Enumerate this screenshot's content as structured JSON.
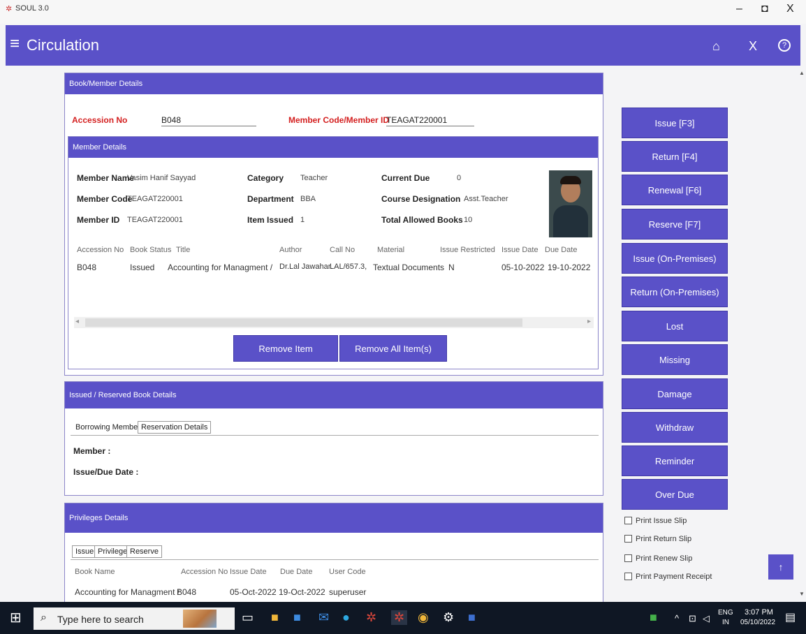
{
  "window": {
    "app_title": "SOUL 3.0",
    "minimize": "–",
    "restore": "◘",
    "close": "X"
  },
  "header": {
    "title": "Circulation",
    "menu_icon": "≡",
    "home_icon": "⌂",
    "close_icon": "X",
    "help_icon": "?"
  },
  "book_member": {
    "section_title": "Book/Member Details",
    "accession_label": "Accession No",
    "accession_value": "B048",
    "member_code_label": "Member Code/Member ID",
    "member_code_value": "TEAGAT220001"
  },
  "member_details": {
    "section_title": "Member Details",
    "fields": {
      "member_name_label": "Member Name",
      "member_name": "Vasim Hanif Sayyad",
      "member_code_label": "Member Code",
      "member_code": "TEAGAT220001",
      "member_id_label": "Member ID",
      "member_id": "TEAGAT220001",
      "category_label": "Category",
      "category": "Teacher",
      "department_label": "Department",
      "department": "BBA",
      "item_issued_label": "Item Issued",
      "item_issued": "1",
      "current_due_label": "Current Due",
      "current_due": "0",
      "course_label": "Course Designation",
      "course": "Asst.Teacher",
      "total_allowed_label": "Total Allowed Books",
      "total_allowed": "10"
    },
    "table_headers": [
      "Accession No",
      "Book Status",
      "Title",
      "Author",
      "Call No",
      "Material",
      "Issue Restricted",
      "Issue Date",
      "Due Date"
    ],
    "table_row": [
      "B048",
      "Issued",
      "Accounting for Managment /",
      "Dr.Lal Jawahar.",
      "LAL/657.3,",
      "Textual Documents",
      "N",
      "05-10-2022",
      "19-10-2022"
    ],
    "remove_item": "Remove Item",
    "remove_all": "Remove All Item(s)"
  },
  "issued_reserved": {
    "section_title": "Issued / Reserved Book Details",
    "tabs": [
      "Borrowing Member",
      "Reservation Details"
    ],
    "member_label": "Member :",
    "issue_due_label": "Issue/Due Date :"
  },
  "privileges": {
    "section_title": "Privileges Details",
    "tabs": [
      "Issue",
      "Privilege",
      "Reserve"
    ],
    "headers": [
      "Book Name",
      "Accession No",
      "Issue Date",
      "Due Date",
      "User Code"
    ],
    "row": [
      "Accounting for Managment /",
      "B048",
      "05-Oct-2022",
      "19-Oct-2022",
      "superuser"
    ]
  },
  "actions": [
    "Issue [F3]",
    "Return [F4]",
    "Renewal [F6]",
    "Reserve [F7]",
    "Issue (On-Premises)",
    "Return (On-Premises)",
    "Lost",
    "Missing",
    "Damage",
    "Withdraw",
    "Reminder",
    "Over Due"
  ],
  "print_options": [
    "Print Issue Slip",
    "Print Return Slip",
    "Print Renew Slip",
    "Print Payment Receipt"
  ],
  "scroll_top_icon": "↑",
  "taskbar": {
    "search_placeholder": "Type here to search",
    "lang_top": "ENG",
    "lang_bottom": "IN",
    "time": "3:07 PM",
    "date": "05/10/2022"
  },
  "colors": {
    "accent": "#5a51c8",
    "required_label": "#d42020"
  }
}
